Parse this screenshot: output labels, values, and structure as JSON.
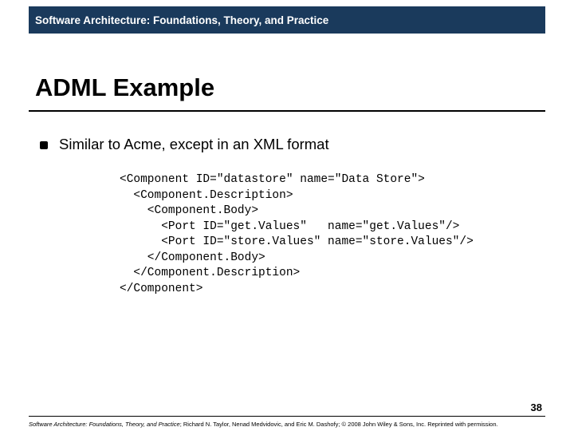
{
  "header": {
    "banner": "Software Architecture: Foundations, Theory, and Practice"
  },
  "title": "ADML Example",
  "bullets": [
    {
      "text": "Similar to Acme, except in an XML format"
    }
  ],
  "code": "<Component ID=\"datastore\" name=\"Data Store\">\n  <Component.Description>\n    <Component.Body>\n      <Port ID=\"get.Values\"   name=\"get.Values\"/>\n      <Port ID=\"store.Values\" name=\"store.Values\"/>\n    </Component.Body>\n  </Component.Description>\n</Component>",
  "page_number": "38",
  "footer": {
    "book": "Software Architecture: Foundations, Theory, and Practice",
    "rest": "; Richard N. Taylor, Nenad Medvidovic, and Eric M. Dashofy; © 2008 John Wiley & Sons, Inc. Reprinted with permission."
  }
}
